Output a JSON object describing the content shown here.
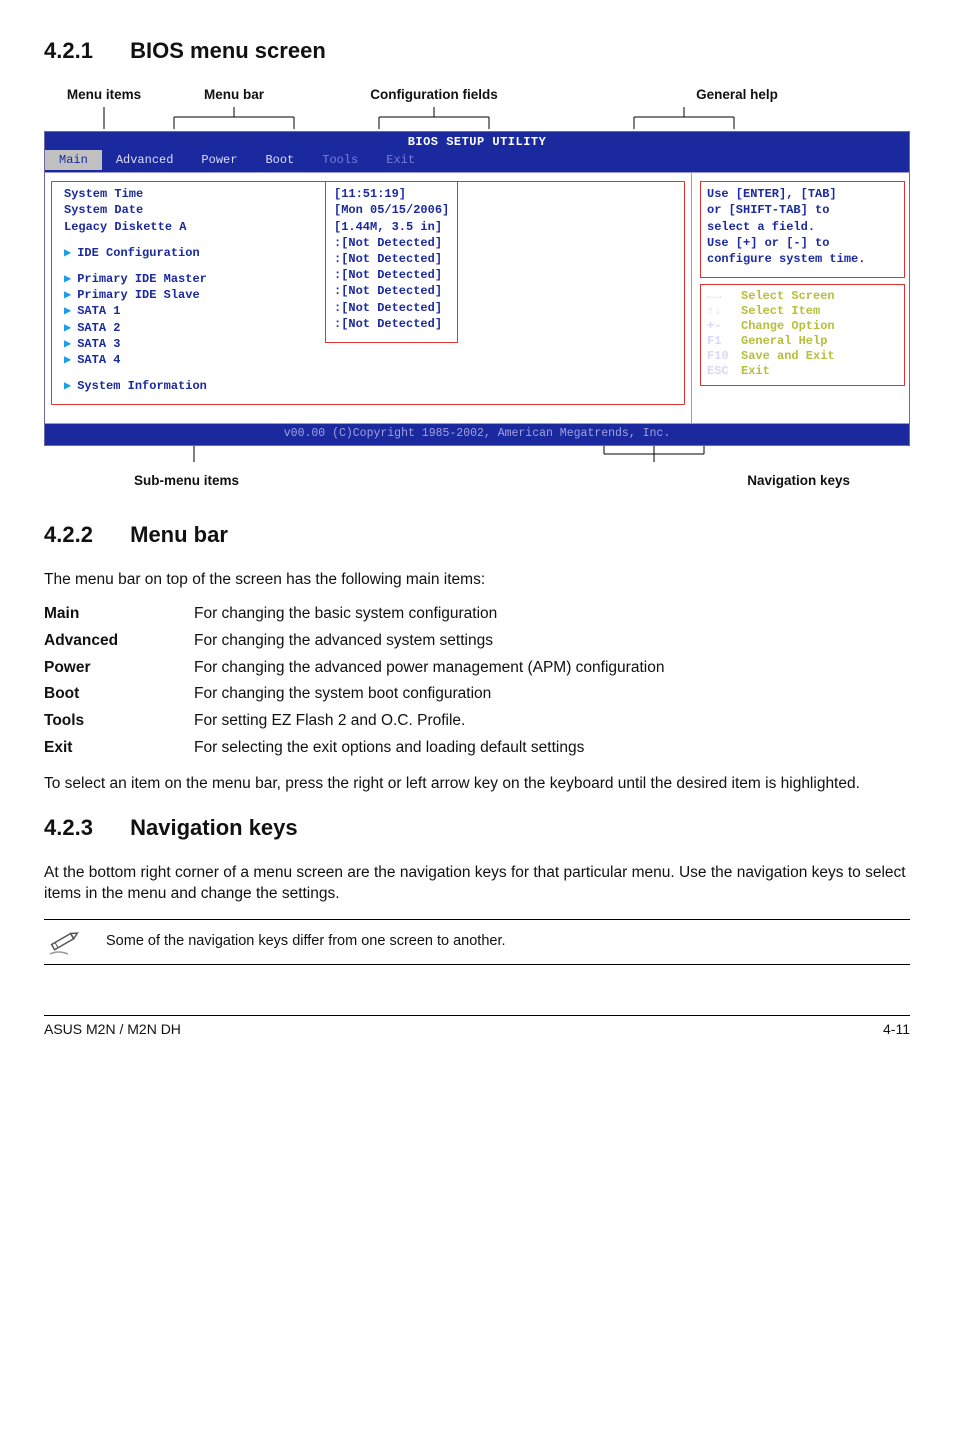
{
  "sections": {
    "s1": {
      "num": "4.2.1",
      "title": "BIOS menu screen"
    },
    "s2": {
      "num": "4.2.2",
      "title": "Menu bar"
    },
    "s3": {
      "num": "4.2.3",
      "title": "Navigation keys"
    }
  },
  "top_labels": {
    "menu_items": "Menu items",
    "menu_bar": "Menu bar",
    "config_fields": "Configuration fields",
    "general_help": "General help"
  },
  "bios": {
    "title": "BIOS SETUP UTILITY",
    "tabs": {
      "main": "Main",
      "advanced": "Advanced",
      "power": "Power",
      "boot": "Boot",
      "tools": "Tools",
      "exit": "Exit"
    },
    "left": {
      "system_time": "System Time",
      "system_date": "System Date",
      "legacy_diskette": "Legacy Diskette A",
      "ide_config": "IDE Configuration",
      "primary_master": "Primary IDE Master",
      "primary_slave": "Primary IDE Slave",
      "sata1": "SATA 1",
      "sata2": "SATA 2",
      "sata3": "SATA 3",
      "sata4": "SATA 4",
      "sysinfo": "System Information"
    },
    "values": {
      "time": "[11:51:19]",
      "date": "[Mon 05/15/2006]",
      "diskette": "[1.44M, 3.5 in]",
      "nd": ":[Not Detected]"
    },
    "help": {
      "l1": "Use [ENTER], [TAB]",
      "l2": "or [SHIFT-TAB] to",
      "l3": "select a field.",
      "l4": "Use [+] or [-] to",
      "l5": "configure system time."
    },
    "nav": {
      "k1": "←→",
      "d1": "Select Screen",
      "k2": "↑↓",
      "d2": "Select Item",
      "k3": "+-",
      "d3": "Change Option",
      "k4": "F1",
      "d4": "General Help",
      "k5": "F10",
      "d5": "Save and Exit",
      "k6": "ESC",
      "d6": "Exit"
    },
    "bottom": "v00.00 (C)Copyright 1985-2002, American Megatrends, Inc."
  },
  "sub_labels": {
    "left": "Sub-menu items",
    "right": "Navigation keys"
  },
  "menubar_intro": "The menu bar on top of the screen has the following main items:",
  "menu_table": {
    "main_k": "Main",
    "main_v": "For changing the basic system configuration",
    "adv_k": "Advanced",
    "adv_v": "For changing the advanced system settings",
    "pow_k": "Power",
    "pow_v": "For changing the advanced power management (APM) configuration",
    "boot_k": "Boot",
    "boot_v": "For changing the system boot configuration",
    "tools_k": "Tools",
    "tools_v": "For setting EZ Flash 2 and O.C. Profile.",
    "exit_k": "Exit",
    "exit_v": "For selecting the exit options and loading default settings"
  },
  "menubar_outro": "To select an item on the menu bar, press the right or left arrow key on the keyboard until the desired item is highlighted.",
  "navkeys_para": "At the bottom right corner of a menu screen are the navigation keys for that particular menu. Use the navigation keys to select items in the menu and change the settings.",
  "note_text": "Some of the navigation keys differ from one screen to another.",
  "footer": {
    "left": "ASUS M2N / M2N DH",
    "right": "4-11"
  }
}
